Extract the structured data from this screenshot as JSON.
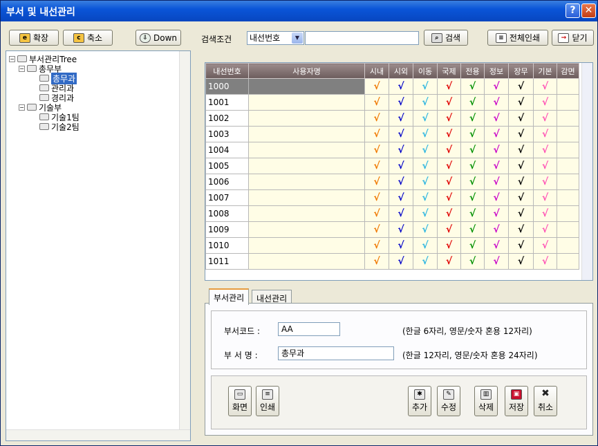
{
  "window": {
    "title": "부서 및 내선관리",
    "help_glyph": "?",
    "close_glyph": "✕"
  },
  "left_toolbar": {
    "expand_label": "확장",
    "collapse_label": "축소",
    "down_label": "Down"
  },
  "tree": {
    "root": "부서관리Tree",
    "groups": [
      {
        "label": "총무부",
        "children": [
          "총무과",
          "관리과",
          "경리과"
        ]
      },
      {
        "label": "기술부",
        "children": [
          "기술1팀",
          "기술2팀"
        ]
      }
    ],
    "selected": "총무과"
  },
  "search": {
    "label": "검색조건",
    "field_value": "내선번호",
    "query_value": "",
    "search_label": "검색",
    "print_all_label": "전체인쇄",
    "close_label": "닫기"
  },
  "grid": {
    "columns": [
      "내선번호",
      "사용자명",
      "시내",
      "시외",
      "이동",
      "국제",
      "전용",
      "정보",
      "장무",
      "기본",
      "감면"
    ],
    "check_colors": [
      "#f07800",
      "#0000c8",
      "#28b4e0",
      "#e00000",
      "#009000",
      "#c800c8",
      "#000000",
      "#ff50b4"
    ],
    "check_glyph": "√",
    "rows": [
      {
        "ext": "1000",
        "user": ""
      },
      {
        "ext": "1001",
        "user": ""
      },
      {
        "ext": "1002",
        "user": ""
      },
      {
        "ext": "1003",
        "user": ""
      },
      {
        "ext": "1004",
        "user": ""
      },
      {
        "ext": "1005",
        "user": ""
      },
      {
        "ext": "1006",
        "user": ""
      },
      {
        "ext": "1007",
        "user": ""
      },
      {
        "ext": "1008",
        "user": ""
      },
      {
        "ext": "1009",
        "user": ""
      },
      {
        "ext": "1010",
        "user": ""
      },
      {
        "ext": "1011",
        "user": ""
      }
    ]
  },
  "tabs": {
    "items": [
      "부서관리",
      "내선관리"
    ],
    "active": "부서관리"
  },
  "form": {
    "code_label": "부서코드 :",
    "code_value": "AA",
    "code_hint": "(한글 6자리, 영문/숫자 혼용 12자리)",
    "name_label": "부 서 명 :",
    "name_value": "총무과",
    "name_hint": "(한글 12자리, 영문/숫자 혼용 24자리)"
  },
  "actions": {
    "screen": "화면",
    "print": "인쇄",
    "add": "추가",
    "edit": "수정",
    "delete": "삭제",
    "save": "저장",
    "cancel": "취소"
  }
}
